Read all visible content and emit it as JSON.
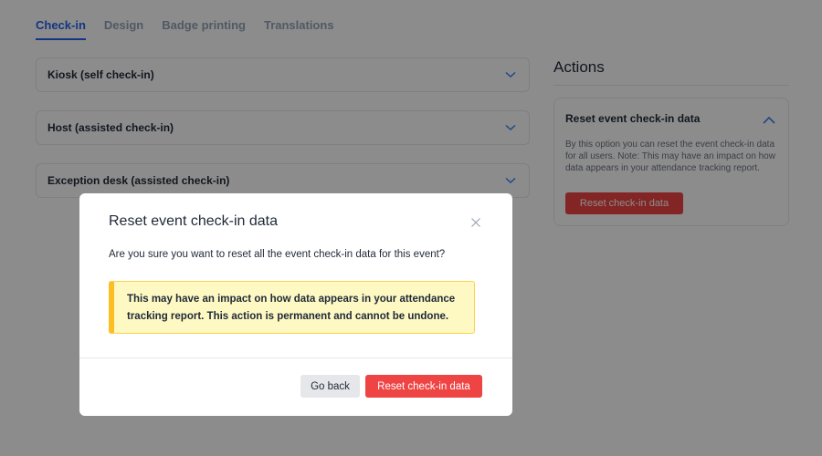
{
  "tabs": [
    {
      "label": "Check-in",
      "active": true
    },
    {
      "label": "Design",
      "active": false
    },
    {
      "label": "Badge printing",
      "active": false
    },
    {
      "label": "Translations",
      "active": false
    }
  ],
  "accordions": [
    {
      "title": "Kiosk (self check-in)",
      "icon": "chevron-down-icon"
    },
    {
      "title": "Host (assisted check-in)",
      "icon": "chevron-down-icon"
    },
    {
      "title": "Exception desk (assisted check-in)",
      "icon": "chevron-down-icon"
    }
  ],
  "actions": {
    "heading": "Actions",
    "card": {
      "title": "Reset event check-in data",
      "icon": "chevron-up-icon",
      "description": "By this option you can reset the event check-in data for all users. Note: This may have an impact on how data appears in your attendance tracking report.",
      "button_label": "Reset check-in data"
    }
  },
  "modal": {
    "title": "Reset event check-in data",
    "close_icon": "close-icon",
    "question": "Are you sure you want to reset all the event check-in data for this event?",
    "warning": "This may have an impact on how data appears in your attendance tracking report. This action is permanent and cannot be undone.",
    "back_label": "Go back",
    "confirm_label": "Reset check-in data"
  },
  "colors": {
    "accent": "#2563eb",
    "danger": "#ef4444",
    "warning_bg": "#fef9c3",
    "warning_border": "#fbbf24"
  }
}
